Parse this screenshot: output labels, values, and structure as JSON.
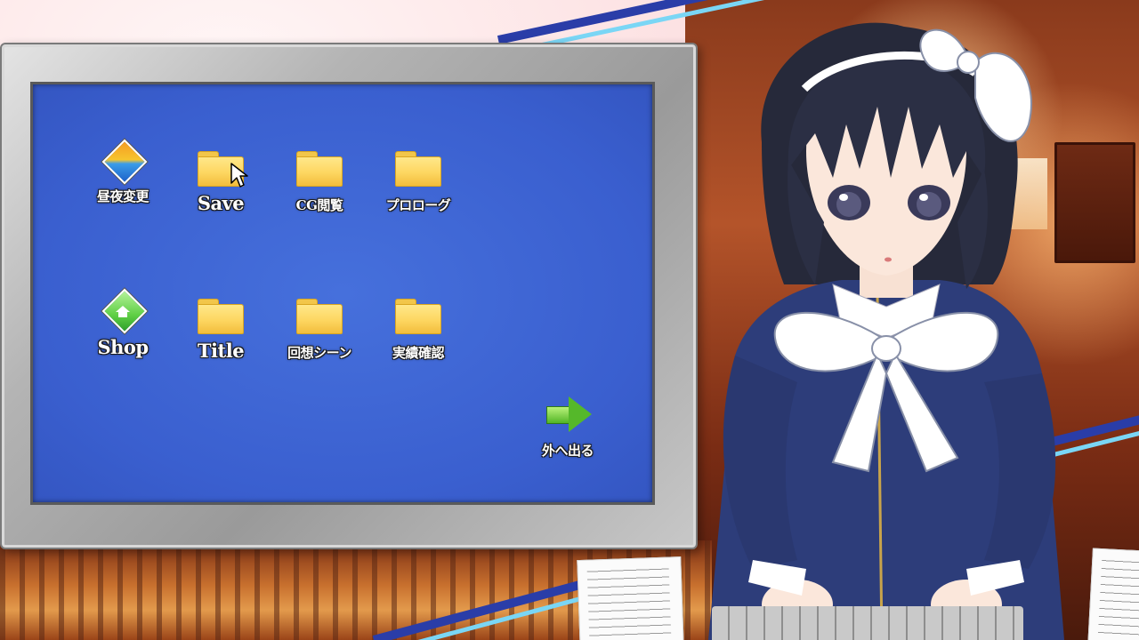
{
  "desktop": {
    "icons": [
      {
        "label": "昼夜変更",
        "icon": "day-night-icon"
      },
      {
        "label": "Save",
        "icon": "folder-icon"
      },
      {
        "label": "CG閲覧",
        "icon": "folder-icon"
      },
      {
        "label": "プロローグ",
        "icon": "folder-icon"
      },
      {
        "label": "Shop",
        "icon": "shop-icon"
      },
      {
        "label": "Title",
        "icon": "folder-icon"
      },
      {
        "label": "回想シーン",
        "icon": "folder-icon"
      },
      {
        "label": "実績確認",
        "icon": "folder-icon"
      }
    ],
    "exit": {
      "label": "外へ出る",
      "icon": "arrow-right-icon"
    }
  },
  "colors": {
    "screen_blue": "#3d63d4",
    "folder_yellow": "#fdd660",
    "accent_blue": "#2a3da8",
    "accent_cyan": "#7ad6f5"
  }
}
